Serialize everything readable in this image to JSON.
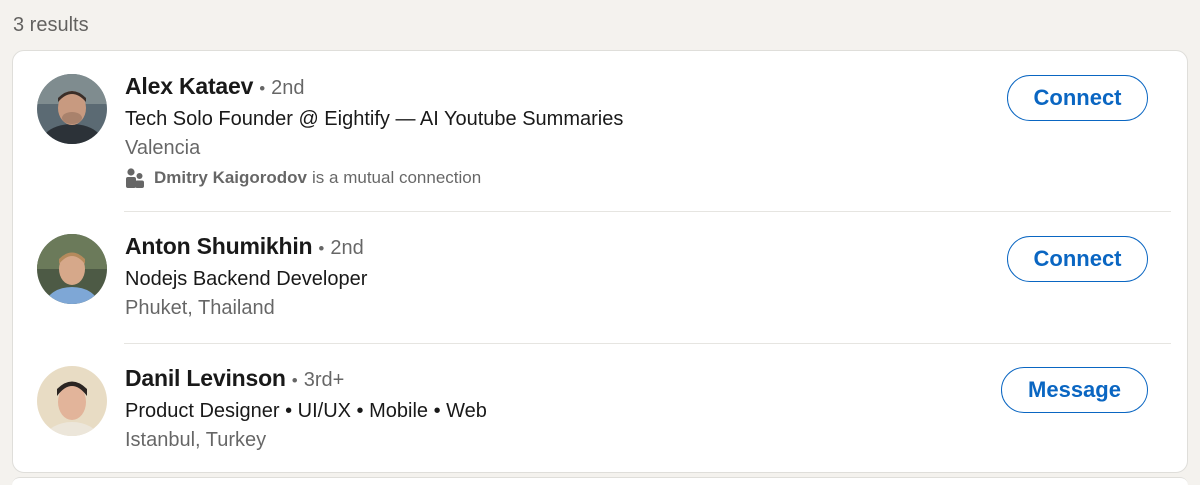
{
  "results": {
    "count_label": "3 results"
  },
  "people": [
    {
      "name": "Alex Kataev",
      "bullet": "•",
      "degree": "2nd",
      "headline": "Tech Solo Founder @ Eightify — AI Youtube Summaries",
      "location": "Valencia",
      "mutual_name": "Dmitry Kaigorodov",
      "mutual_suffix": "is a mutual connection",
      "action_label": "Connect"
    },
    {
      "name": "Anton Shumikhin",
      "bullet": "•",
      "degree": "2nd",
      "headline": "Nodejs Backend Developer",
      "location": "Phuket, Thailand",
      "action_label": "Connect"
    },
    {
      "name": "Danil Levinson",
      "bullet": "•",
      "degree": "3rd+",
      "headline": "Product Designer • UI/UX • Mobile • Web",
      "location": "Istanbul, Turkey",
      "action_label": "Message"
    }
  ],
  "icons": {
    "mutual": "people-icon",
    "avatar": "profile-photo"
  },
  "colors": {
    "page_bg": "#f4f2ee",
    "card_bg": "#ffffff",
    "accent": "#0a66c2",
    "primary_text": "#191919",
    "secondary_text": "#666666"
  }
}
